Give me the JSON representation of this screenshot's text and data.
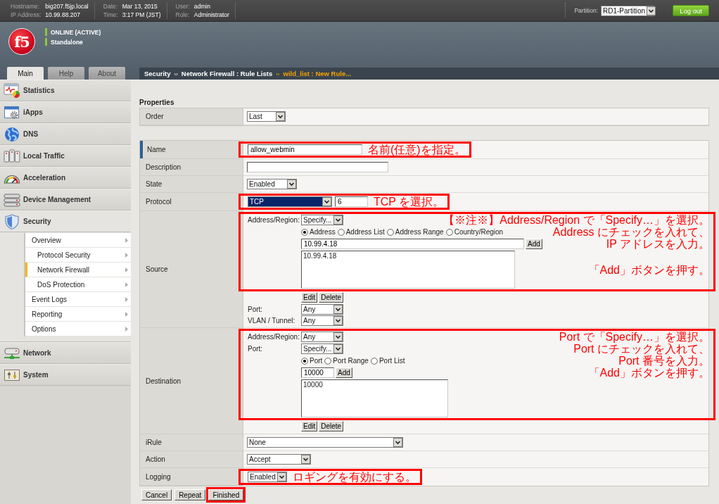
{
  "top_bar": {
    "info_groups": [
      {
        "items": [
          {
            "label": "Hostname:",
            "value": "big207.f5jp.local"
          },
          {
            "label": "IP Address:",
            "value": "10.99.88.207"
          }
        ]
      },
      {
        "items": [
          {
            "label": "Date:",
            "value": "Mar 13, 2015"
          },
          {
            "label": "Time:",
            "value": "3:17 PM (JST)"
          }
        ]
      },
      {
        "items": [
          {
            "label": "User:",
            "value": "admin"
          },
          {
            "label": "Role:",
            "value": "Administrator"
          }
        ]
      }
    ],
    "partition": {
      "label": "Partition:",
      "value": "RD1-Partition"
    },
    "logout_button": "Log out"
  },
  "header": {
    "logo": "f5",
    "status": [
      {
        "text": "ONLINE (ACTIVE)",
        "color": "#8dc63f"
      },
      {
        "text": "Standalone",
        "color": "#8dc63f"
      }
    ]
  },
  "nav_tabs": [
    {
      "label": "Main",
      "selected": true
    },
    {
      "label": "Help",
      "selected": false
    },
    {
      "label": "About",
      "selected": false
    }
  ],
  "breadcrumb": [
    {
      "text": "Security",
      "kind": "crumb",
      "highlighted": false
    },
    {
      "text": "››",
      "kind": "separator",
      "highlighted": false
    },
    {
      "text": "Network Firewall : Rule Lists",
      "kind": "crumb",
      "highlighted": false
    },
    {
      "text": "››",
      "kind": "separator",
      "highlighted": true
    },
    {
      "text": "wild_list : New Rule...",
      "kind": "crumb",
      "highlighted": true
    }
  ],
  "sidebar": {
    "items": [
      {
        "label": "Statistics",
        "selected": false
      },
      {
        "label": "iApps",
        "selected": false
      },
      {
        "label": "DNS",
        "selected": false
      },
      {
        "label": "Local Traffic",
        "selected": false
      },
      {
        "label": "Acceleration",
        "selected": false
      },
      {
        "label": "Device Management",
        "selected": false
      },
      {
        "label": "Security",
        "selected": true,
        "children": [
          {
            "label": "Overview",
            "selected": false,
            "children": [
              {
                "label": "Protocol Security",
                "selected": false
              },
              {
                "label": "Network Firewall",
                "selected": true
              },
              {
                "label": "DoS Protection",
                "selected": false
              }
            ]
          },
          {
            "label": "Event Logs",
            "selected": false
          },
          {
            "label": "Reporting",
            "selected": false
          },
          {
            "label": "Options",
            "selected": false
          }
        ]
      },
      {
        "label": "Network",
        "selected": false
      },
      {
        "label": "System",
        "selected": false
      }
    ]
  },
  "rule_form": {
    "section_title": "Properties",
    "order": {
      "label": "Order",
      "required": false,
      "value": "Last"
    },
    "name": {
      "label": "Name",
      "required": true,
      "value": "allow_webmin",
      "annotation": [
        "名前(任意)を指定。"
      ]
    },
    "description": {
      "label": "Description",
      "required": false
    },
    "state": {
      "label": "State",
      "required": false,
      "value": "Enabled"
    },
    "protocol": {
      "label": "Protocol",
      "required": false,
      "value": "TCP",
      "focused": true,
      "number": "6",
      "annotation": [
        "TCP を選択。"
      ]
    },
    "source": {
      "label": "Source",
      "required": false,
      "address_region": {
        "label": "Address/Region:",
        "value": "Specify..."
      },
      "address_types": [
        {
          "label": "Address",
          "selected": true
        },
        {
          "label": "Address List",
          "selected": false
        },
        {
          "label": "Address Range",
          "selected": false
        },
        {
          "label": "Country/Region",
          "selected": false
        }
      ],
      "address_input": "10.99.4.18",
      "add_button": "Add",
      "address_list": [
        "10.99.4.18"
      ],
      "edit_button": "Edit",
      "delete_button": "Delete",
      "port": {
        "label": "Port:",
        "value": "Any"
      },
      "vlan_tunnel": {
        "label": "VLAN / Tunnel:",
        "value": "Any"
      },
      "annotation": [
        "【※注※】Address/Region で「Specify…」を選択。",
        "Address にチェックを入れて、",
        "IP アドレスを入力。",
        "「Add」ボタンを押す。"
      ]
    },
    "destination": {
      "label": "Destination",
      "required": false,
      "address_region": {
        "label": "Address/Region:",
        "value": "Any"
      },
      "port": {
        "label": "Port:",
        "value": "Specify..."
      },
      "port_types": [
        {
          "label": "Port",
          "selected": true
        },
        {
          "label": "Port Range",
          "selected": false
        },
        {
          "label": "Port List",
          "selected": false
        }
      ],
      "port_input": "10000",
      "add_button": "Add",
      "port_list": [
        "10000"
      ],
      "edit_button": "Edit",
      "delete_button": "Delete",
      "annotation": [
        "Port で「Specify…」を選択。",
        "Port にチェックを入れて、",
        "Port 番号を入力。",
        "「Add」ボタンを押す。"
      ]
    },
    "irule": {
      "label": "iRule",
      "required": false,
      "value": "None"
    },
    "action": {
      "label": "Action",
      "required": false,
      "value": "Accept"
    },
    "logging": {
      "label": "Logging",
      "required": false,
      "value": "Enabled",
      "annotation": [
        "ロギングを有効にする。"
      ]
    },
    "buttons": [
      {
        "label": "Cancel",
        "highlighted": false
      },
      {
        "label": "Repeat",
        "highlighted": false
      },
      {
        "label": "Finished",
        "highlighted": true
      }
    ]
  }
}
